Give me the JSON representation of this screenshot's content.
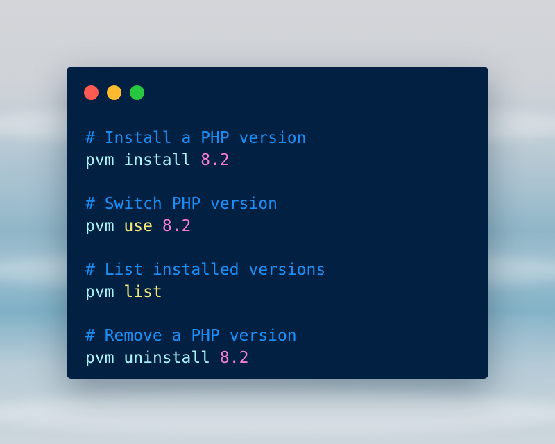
{
  "colors": {
    "window_bg": "#022042",
    "dot_red": "#fd5a53",
    "dot_yellow": "#fdbb2d",
    "dot_green": "#27c83f",
    "comment": "#1c8ff7",
    "command": "#a9f2f8",
    "keyword": "#f7e97a",
    "number": "#f47ccf"
  },
  "window": {
    "controls": [
      "close-dot",
      "minimize-dot",
      "maximize-dot"
    ]
  },
  "code": {
    "blocks": [
      {
        "comment": "# Install a PHP version",
        "cmd": "pvm",
        "sub": "install",
        "arg": "8.2"
      },
      {
        "comment": "# Switch PHP version",
        "cmd": "pvm",
        "sub": "use",
        "arg": "8.2"
      },
      {
        "comment": "# List installed versions",
        "cmd": "pvm",
        "sub": "list",
        "arg": ""
      },
      {
        "comment": "# Remove a PHP version",
        "cmd": "pvm",
        "sub": "uninstall",
        "arg": "8.2"
      }
    ]
  }
}
